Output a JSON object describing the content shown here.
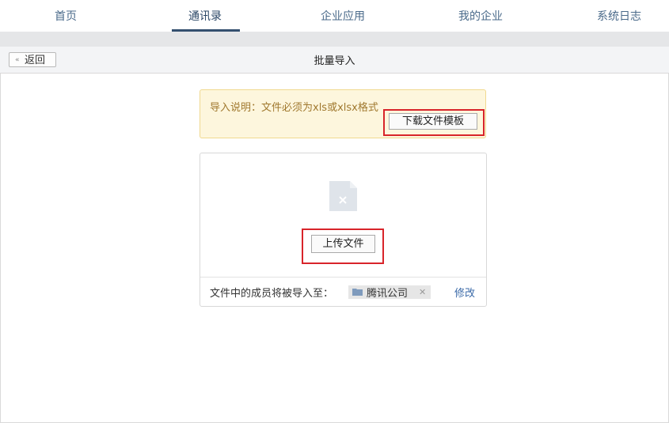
{
  "nav": {
    "items": [
      {
        "label": "首页"
      },
      {
        "label": "通讯录"
      },
      {
        "label": "企业应用"
      },
      {
        "label": "我的企业"
      },
      {
        "label": "系统日志"
      }
    ],
    "active_index": 1
  },
  "subheader": {
    "back_label": "返回",
    "back_icon": "double-chevron-left-icon",
    "title": "批量导入"
  },
  "notice": {
    "text": "导入说明：文件必须为xls或xlsx格式",
    "download_button": "下载文件模板"
  },
  "upload": {
    "file_icon": "file-invalid-icon",
    "upload_button": "上传文件",
    "destination_label": "文件中的成员将被导入至：",
    "destination_name": "腾讯公司",
    "destination_icon": "folder-icon",
    "remove_icon": "close-icon",
    "modify_label": "修改"
  },
  "colors": {
    "nav_text": "#4a6a8a",
    "nav_active_underline": "#34506f",
    "notice_bg": "#fdf6dd",
    "notice_text": "#a0782e",
    "highlight_red": "#d8242a",
    "link_blue": "#3b6aa8"
  }
}
